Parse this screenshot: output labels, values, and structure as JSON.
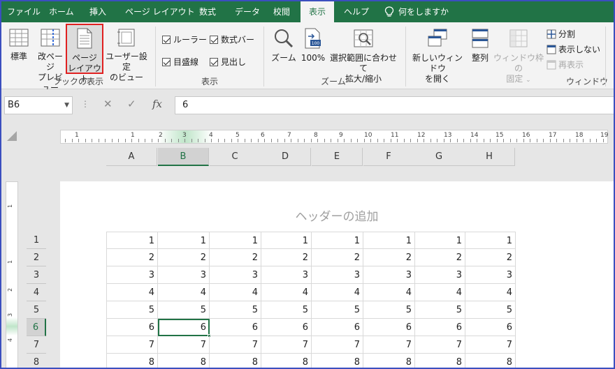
{
  "tabs": [
    {
      "label": "ファイル",
      "active": false
    },
    {
      "label": "ホーム",
      "active": false
    },
    {
      "label": "挿入",
      "active": false
    },
    {
      "label": "ページ レイアウト",
      "active": false
    },
    {
      "label": "数式",
      "active": false
    },
    {
      "label": "データ",
      "active": false
    },
    {
      "label": "校閲",
      "active": false
    },
    {
      "label": "表示",
      "active": true
    },
    {
      "label": "ヘルプ",
      "active": false
    }
  ],
  "tell_me": "何をしますか",
  "ribbon": {
    "workbook_views": {
      "group_label": "ブックの表示",
      "normal": "標準",
      "page_break_1": "改ページ",
      "page_break_2": "プレビュー",
      "page_layout_1": "ページ",
      "page_layout_2": "レイアウト",
      "custom_1": "ユーザー設定",
      "custom_2": "のビュー"
    },
    "show": {
      "group_label": "表示",
      "ruler": "ルーラー",
      "formula_bar": "数式バー",
      "gridlines": "目盛線",
      "headings": "見出し"
    },
    "zoom": {
      "group_label": "ズーム",
      "zoom": "ズーム",
      "hundred": "100%",
      "zoom_sel_1": "選択範囲に合わせて",
      "zoom_sel_2": "拡大/縮小"
    },
    "window": {
      "group_label": "ウィンドウ",
      "new_1": "新しいウィンドウ",
      "new_2": "を開く",
      "arrange": "整列",
      "freeze_1": "ウィンドウ枠の",
      "freeze_2": "固定",
      "split": "分割",
      "hide": "表示しない",
      "unhide": "再表示"
    }
  },
  "formula_bar": {
    "name_box": "B6",
    "fx": "fx",
    "value": "6"
  },
  "ruler_numbers": [
    "1",
    "1",
    "2",
    "3",
    "4",
    "5",
    "6",
    "7",
    "8",
    "9",
    "10",
    "11",
    "12",
    "13",
    "14",
    "15",
    "16",
    "17",
    "18",
    "19"
  ],
  "vruler_numbers": [
    "1",
    "1",
    "2",
    "3",
    "4"
  ],
  "columns": [
    "A",
    "B",
    "C",
    "D",
    "E",
    "F",
    "G",
    "H"
  ],
  "selected_column": "B",
  "header_placeholder": "ヘッダーの追加",
  "rows": [
    {
      "num": "1",
      "cells": [
        "1",
        "1",
        "1",
        "1",
        "1",
        "1",
        "1",
        "1"
      ]
    },
    {
      "num": "2",
      "cells": [
        "2",
        "2",
        "2",
        "2",
        "2",
        "2",
        "2",
        "2"
      ]
    },
    {
      "num": "3",
      "cells": [
        "3",
        "3",
        "3",
        "3",
        "3",
        "3",
        "3",
        "3"
      ]
    },
    {
      "num": "4",
      "cells": [
        "4",
        "4",
        "4",
        "4",
        "4",
        "4",
        "4",
        "4"
      ]
    },
    {
      "num": "5",
      "cells": [
        "5",
        "5",
        "5",
        "5",
        "5",
        "5",
        "5",
        "5"
      ]
    },
    {
      "num": "6",
      "cells": [
        "6",
        "6",
        "6",
        "6",
        "6",
        "6",
        "6",
        "6"
      ]
    },
    {
      "num": "7",
      "cells": [
        "7",
        "7",
        "7",
        "7",
        "7",
        "7",
        "7",
        "7"
      ]
    },
    {
      "num": "8",
      "cells": [
        "8",
        "8",
        "8",
        "8",
        "8",
        "8",
        "8",
        "8"
      ]
    }
  ],
  "active_cell": "B6",
  "colors": {
    "accent": "#217346",
    "highlight_box": "#e02020",
    "frame": "#3b4fbf"
  }
}
